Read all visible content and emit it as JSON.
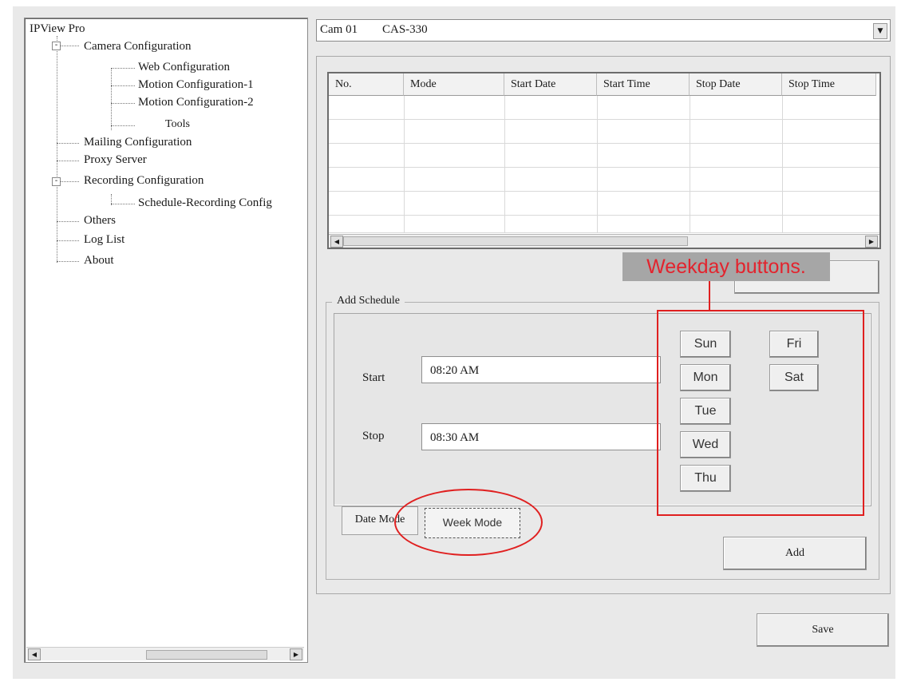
{
  "tree": {
    "root": "IPView Pro",
    "items": [
      {
        "label": "Camera Configuration",
        "expander": "-"
      },
      {
        "label": "Web Configuration"
      },
      {
        "label": "Motion Configuration-1"
      },
      {
        "label": "Motion Configuration-2"
      },
      {
        "label": "Tools"
      },
      {
        "label": "Mailing Configuration"
      },
      {
        "label": "Proxy Server"
      },
      {
        "label": "Recording Configuration",
        "expander": "-"
      },
      {
        "label": "Schedule-Recording Config"
      },
      {
        "label": "Others"
      },
      {
        "label": "Log List"
      },
      {
        "label": "About"
      }
    ]
  },
  "camera_select": {
    "id": "Cam 01",
    "model": "CAS-330"
  },
  "schedule_table": {
    "columns": [
      "No.",
      "Mode",
      "Start Date",
      "Start Time",
      "Stop Date",
      "Stop Time"
    ],
    "rows": []
  },
  "add_schedule": {
    "legend": "Add Schedule",
    "start_label": "Start",
    "start_value": "08:20 AM",
    "stop_label": "Stop",
    "stop_value": "08:30 AM",
    "weekdays": [
      "Sun",
      "Mon",
      "Tue",
      "Wed",
      "Thu",
      "Fri",
      "Sat"
    ],
    "tabs": [
      "Date Mode",
      "Week Mode"
    ],
    "add_label": "Add"
  },
  "save_label": "Save",
  "annotation": {
    "label": "Weekday buttons.",
    "color": "#e02020"
  }
}
